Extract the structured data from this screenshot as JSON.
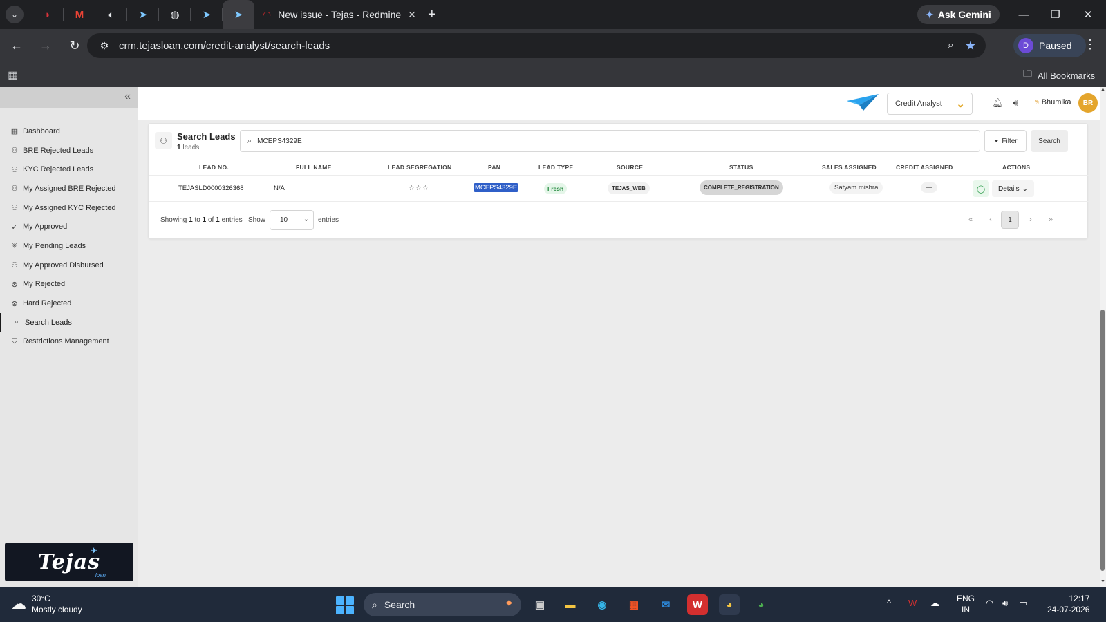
{
  "browser": {
    "active_tab_title": "New issue - Tejas - Redmine",
    "gemini_label": "Ask Gemini",
    "url": "crm.tejasloan.com/credit-analyst/search-leads",
    "profile_initial": "D",
    "profile_status": "Paused",
    "all_bookmarks_label": "All Bookmarks"
  },
  "sidebar": {
    "items": [
      {
        "label": "Dashboard",
        "icon": "dashboard-icon",
        "glyph": "▦"
      },
      {
        "label": "BRE Rejected Leads",
        "icon": "users-icon",
        "glyph": "⚇"
      },
      {
        "label": "KYC Rejected Leads",
        "icon": "users-icon",
        "glyph": "⚇"
      },
      {
        "label": "My Assigned BRE Rejected",
        "icon": "user-check-icon",
        "glyph": "⚇"
      },
      {
        "label": "My Assigned KYC Rejected",
        "icon": "user-check-icon",
        "glyph": "⚇"
      },
      {
        "label": "My Approved",
        "icon": "check-circle-icon",
        "glyph": "✓"
      },
      {
        "label": "My Pending Leads",
        "icon": "loader-icon",
        "glyph": "✳"
      },
      {
        "label": "My Approved Disbursed",
        "icon": "users-icon",
        "glyph": "⚇"
      },
      {
        "label": "My Rejected",
        "icon": "x-circle-icon",
        "glyph": "⊗"
      },
      {
        "label": "Hard Rejected",
        "icon": "x-circle-icon",
        "glyph": "⊗"
      },
      {
        "label": "Search Leads",
        "icon": "search-icon",
        "glyph": "⌕"
      },
      {
        "label": "Restrictions Management",
        "icon": "shield-icon",
        "glyph": "⛉"
      }
    ],
    "logo_text": "Tejas",
    "logo_sub": "loan"
  },
  "header": {
    "role": "Credit Analyst",
    "user_name": "Bhumika",
    "user_initials": "BR"
  },
  "search": {
    "title": "Search Leads",
    "count": "1",
    "count_suffix": "leads",
    "query": "MCEPS4329E",
    "filter_label": "Filter",
    "search_label": "Search"
  },
  "table": {
    "columns": [
      "LEAD NO.",
      "FULL NAME",
      "LEAD SEGREGATION",
      "PAN",
      "LEAD TYPE",
      "SOURCE",
      "STATUS",
      "SALES ASSIGNED",
      "CREDIT ASSIGNED",
      "ACTIONS"
    ],
    "rows": [
      {
        "lead_no": "TEJASLD0000326368",
        "full_name": "N/A",
        "segregation_stars": "☆☆☆",
        "pan": "MCEPS4329E",
        "lead_type": "Fresh",
        "source": "TEJAS_WEB",
        "status": "COMPLETE_REGISTRATION",
        "sales_assigned": "Satyam mishra",
        "credit_assigned": "—",
        "details_label": "Details"
      }
    ]
  },
  "pagination": {
    "showing_prefix": "Showing",
    "from": "1",
    "to_word": "to",
    "to": "1",
    "of_word": "of",
    "total": "1",
    "entries_word": "entries",
    "show_label": "Show",
    "page_size": "10",
    "entries_label": "entries",
    "current_page": "1"
  },
  "taskbar": {
    "temperature": "30°C",
    "weather": "Mostly cloudy",
    "search_label": "Search",
    "lang_line1": "ENG",
    "lang_line2": "IN",
    "time": "12:17",
    "date": "24-07-2026"
  },
  "colors": {
    "accent_highlight": "#2f5fc8",
    "fresh_green": "#23893e",
    "avatar_orange": "#e4a52c"
  }
}
